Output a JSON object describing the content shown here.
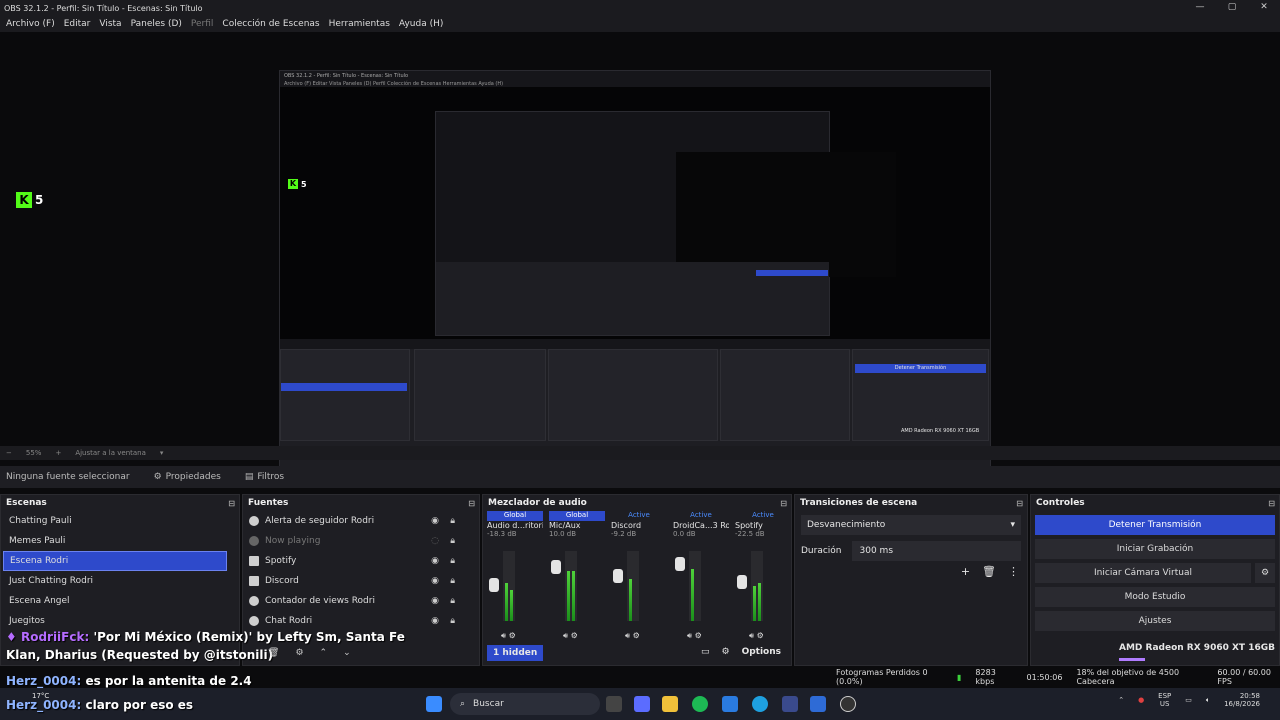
{
  "window": {
    "title": "OBS 32.1.2 - Perfil: Sin Título - Escenas: Sin Título",
    "controls": [
      "—",
      "▢",
      "✕"
    ]
  },
  "menu": [
    {
      "label": "Archivo (F)",
      "dim": false
    },
    {
      "label": "Editar",
      "dim": false
    },
    {
      "label": "Vista",
      "dim": false
    },
    {
      "label": "Paneles (D)",
      "dim": false
    },
    {
      "label": "Perfil",
      "dim": true
    },
    {
      "label": "Colección de Escenas",
      "dim": false
    },
    {
      "label": "Herramientas",
      "dim": false
    },
    {
      "label": "Ayuda (H)",
      "dim": false
    }
  ],
  "preview": {
    "kick_count": "5",
    "zoom": "55%",
    "fit_label": "Ajustar a la ventana",
    "nested_title": "OBS 32.1.2 - Perfil: Sin Título - Escenas: Sin Título",
    "nested_menu": "Archivo (F)  Editar  Vista  Paneles (D)  Perfil  Colección de Escenas  Herramientas  Ayuda (H)",
    "nested_transmit": "Detener Transmisión",
    "nested_gpu": "AMD Radeon RX 9060 XT 16GB"
  },
  "sources_bar": {
    "no_source": "Ninguna fuente seleccionar",
    "properties": "Propiedades",
    "filters": "Filtros"
  },
  "scenes": {
    "title": "Escenas",
    "items": [
      "Chatting Pauli",
      "Memes Pauli",
      "Escena Rodri",
      "Just Chatting Rodri",
      "Escena Angel",
      "Juegitos"
    ],
    "selected": "Escena Rodri"
  },
  "sources": {
    "title": "Fuentes",
    "items": [
      {
        "label": "Alerta de seguidor Rodri",
        "dim": false
      },
      {
        "label": "Now playing",
        "dim": true
      },
      {
        "label": "Spotify",
        "dim": false
      },
      {
        "label": "Discord",
        "dim": false
      },
      {
        "label": "Contador de views Rodri",
        "dim": false
      },
      {
        "label": "Chat Rodri",
        "dim": false
      }
    ]
  },
  "mixer": {
    "title": "Mezclador de audio",
    "channels": [
      {
        "badge": "Global",
        "badge_type": "g",
        "name": "Audio d...ritorio",
        "db": "-18.3 dB",
        "level": 0.55,
        "level2": 0.45,
        "knob": 0.45
      },
      {
        "badge": "Global",
        "badge_type": "g",
        "name": "Mic/Aux",
        "db": "10.0 dB",
        "level": 0.72,
        "level2": 0.72,
        "knob": 0.15
      },
      {
        "badge": "Active",
        "badge_type": "a",
        "name": "Discord",
        "db": "-9.2 dB",
        "level": 0.6,
        "level2": 0.0,
        "knob": 0.3
      },
      {
        "badge": "Active",
        "badge_type": "a",
        "name": "DroidCa...3 Rodri",
        "db": "0.0 dB",
        "level": 0.75,
        "level2": 0.0,
        "knob": 0.1
      },
      {
        "badge": "Active",
        "badge_type": "a",
        "name": "Spotify",
        "db": "-22.5 dB",
        "level": 0.5,
        "level2": 0.55,
        "knob": 0.4
      }
    ],
    "hidden_label": "1 hidden",
    "options_label": "Options"
  },
  "transitions": {
    "title": "Transiciones de escena",
    "selected": "Desvanecimiento",
    "duration_label": "Duración",
    "duration_value": "300 ms"
  },
  "controls": {
    "title": "Controles",
    "buttons": [
      {
        "label": "Detener Transmisión",
        "primary": true
      },
      {
        "label": "Iniciar Grabación",
        "primary": false
      },
      {
        "label": "Iniciar Cámara Virtual",
        "primary": false
      },
      {
        "label": "Modo Estudio",
        "primary": false
      },
      {
        "label": "Ajustes",
        "primary": false
      }
    ],
    "gpu": "AMD Radeon RX 9060 XT 16GB",
    "gpu_sub": "18% del objetivo de 4500 Cabecera"
  },
  "chat": {
    "line1_user": "RodriiFck:",
    "line1_text": "'Por Mi México (Remix)' by Lefty Sm, Santa Fe",
    "line2_text": "Klan, Dharius (Requested by @itstonili)",
    "line3_user": "Herz_0004:",
    "line3_text": "es por la antenita de 2.4",
    "line4_user": "Herz_0004:",
    "line4_text": "claro por eso es"
  },
  "status": {
    "dropped": "Fotogramas Perdidos 0 (0.0%)",
    "bitrate": "8283 kbps",
    "time": "01:50:06",
    "fps": "60.00 / 60.00 FPS"
  },
  "taskbar": {
    "search": "Buscar",
    "temp": "17°C",
    "lang": "ESP",
    "region": "US",
    "clock": "20:58",
    "date": "16/8/2026"
  }
}
